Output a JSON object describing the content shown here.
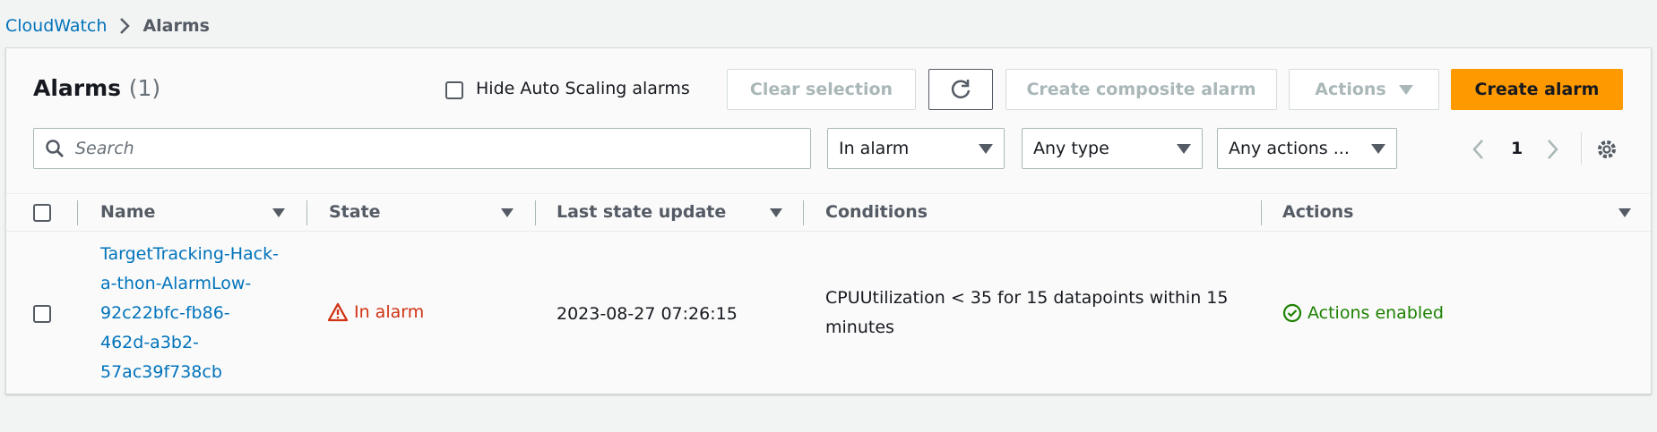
{
  "breadcrumb": {
    "root": "CloudWatch",
    "current": "Alarms"
  },
  "header": {
    "title": "Alarms",
    "count": "(1)",
    "hide_autoscaling_label": "Hide Auto Scaling alarms",
    "hide_autoscaling_checked": false
  },
  "toolbar": {
    "clear_selection": "Clear selection",
    "refresh_icon": "refresh-icon",
    "create_composite": "Create composite alarm",
    "actions": "Actions",
    "create_alarm": "Create alarm"
  },
  "filters": {
    "search_placeholder": "Search",
    "search_value": "",
    "state": "In alarm",
    "type": "Any type",
    "actions": "Any actions ..."
  },
  "pagination": {
    "current_page": "1"
  },
  "table": {
    "columns": [
      "Name",
      "State",
      "Last state update",
      "Conditions",
      "Actions"
    ],
    "rows": [
      {
        "name_lines": [
          "TargetTracking-Hack-",
          "a-thon-AlarmLow-",
          "92c22bfc-fb86-",
          "462d-a3b2-",
          "57ac39f738cb"
        ],
        "state": "In alarm",
        "last_update": "2023-08-27 07:26:15",
        "conditions_lines": [
          "CPUUtilization < 35 for 15 datapoints within 15",
          "minutes"
        ],
        "actions": "Actions enabled"
      }
    ]
  },
  "colors": {
    "accent": "#ff9900",
    "link": "#0073bb",
    "alarm": "#d13212",
    "success": "#1d8102"
  }
}
